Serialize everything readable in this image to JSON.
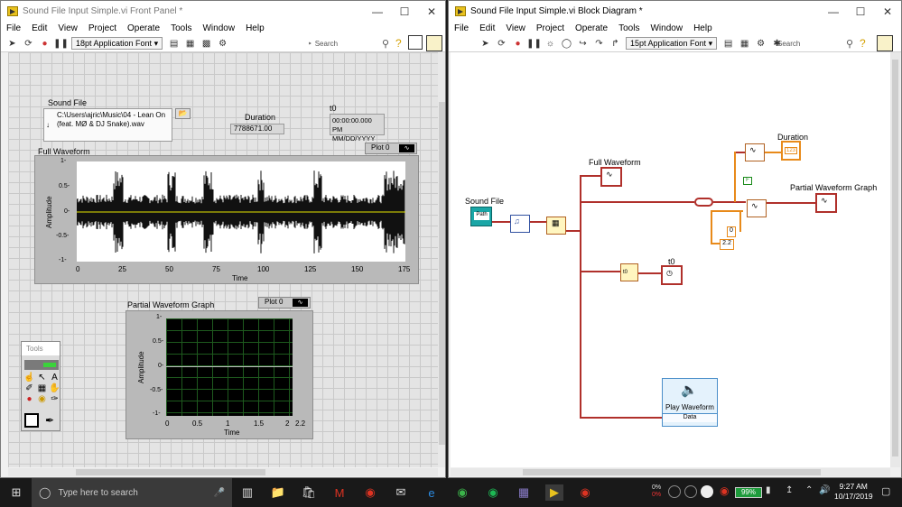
{
  "front_panel": {
    "title": "Sound File Input Simple.vi Front Panel *",
    "menu": [
      "File",
      "Edit",
      "View",
      "Project",
      "Operate",
      "Tools",
      "Window",
      "Help"
    ],
    "font": "18pt Application Font",
    "search_placeholder": "Search",
    "sound_file": {
      "label": "Sound File",
      "path": "C:\\Users\\ajric\\Music\\04 - Lean On (feat. MØ & DJ Snake).wav"
    },
    "duration": {
      "label": "Duration",
      "value": "7788671.00"
    },
    "t0": {
      "label": "t0",
      "value": "00:00:00.000 PM",
      "date": "MM/DD/YYYY"
    },
    "full_waveform": {
      "label": "Full Waveform",
      "plot_legend": "Plot 0",
      "ylabel": "Amplitude",
      "xlabel": "Time",
      "yticks": [
        "1-",
        "0.5-",
        "0-",
        "-0.5-",
        "-1-"
      ],
      "xticks": [
        "0",
        "25",
        "50",
        "75",
        "100",
        "125",
        "150",
        "175"
      ]
    },
    "partial_waveform": {
      "label": "Partial Waveform Graph",
      "plot_legend": "Plot 0",
      "ylabel": "Amplitude",
      "xlabel": "Time",
      "yticks": [
        "1-",
        "0.5-",
        "0-",
        "-0.5-",
        "-1-"
      ],
      "xticks": [
        "0",
        "0.5",
        "1",
        "1.5",
        "2",
        "2.2"
      ]
    },
    "tools_palette": {
      "title": "Tools"
    }
  },
  "block_diagram": {
    "title": "Sound File Input Simple.vi Block Diagram *",
    "menu": [
      "File",
      "Edit",
      "View",
      "Project",
      "Operate",
      "Tools",
      "Window",
      "Help"
    ],
    "font": "15pt Application Font",
    "search_placeholder": "Search",
    "labels": {
      "sound_file": "Sound File",
      "path_glyph": "Path",
      "full_waveform": "Full Waveform",
      "duration": "Duration",
      "duration_glyph": "123",
      "partial_waveform": "Partial Waveform Graph",
      "t0": "t0",
      "t0_node": "t0",
      "const_0": "0",
      "const_22": "2.2",
      "play_waveform": "Play Waveform",
      "play_data": "Data"
    }
  },
  "taskbar": {
    "search_placeholder": "Type here to search",
    "cpu": "0%",
    "cpu2": "0%",
    "battery": "99%",
    "time": "9:27 AM",
    "date": "10/17/2019"
  },
  "colors": {
    "accent": "#e9c21e",
    "graph_bg": "#000000",
    "plot_line": "#e6e600",
    "wire_red": "#b0302b",
    "wire_orange": "#e88a1a"
  }
}
